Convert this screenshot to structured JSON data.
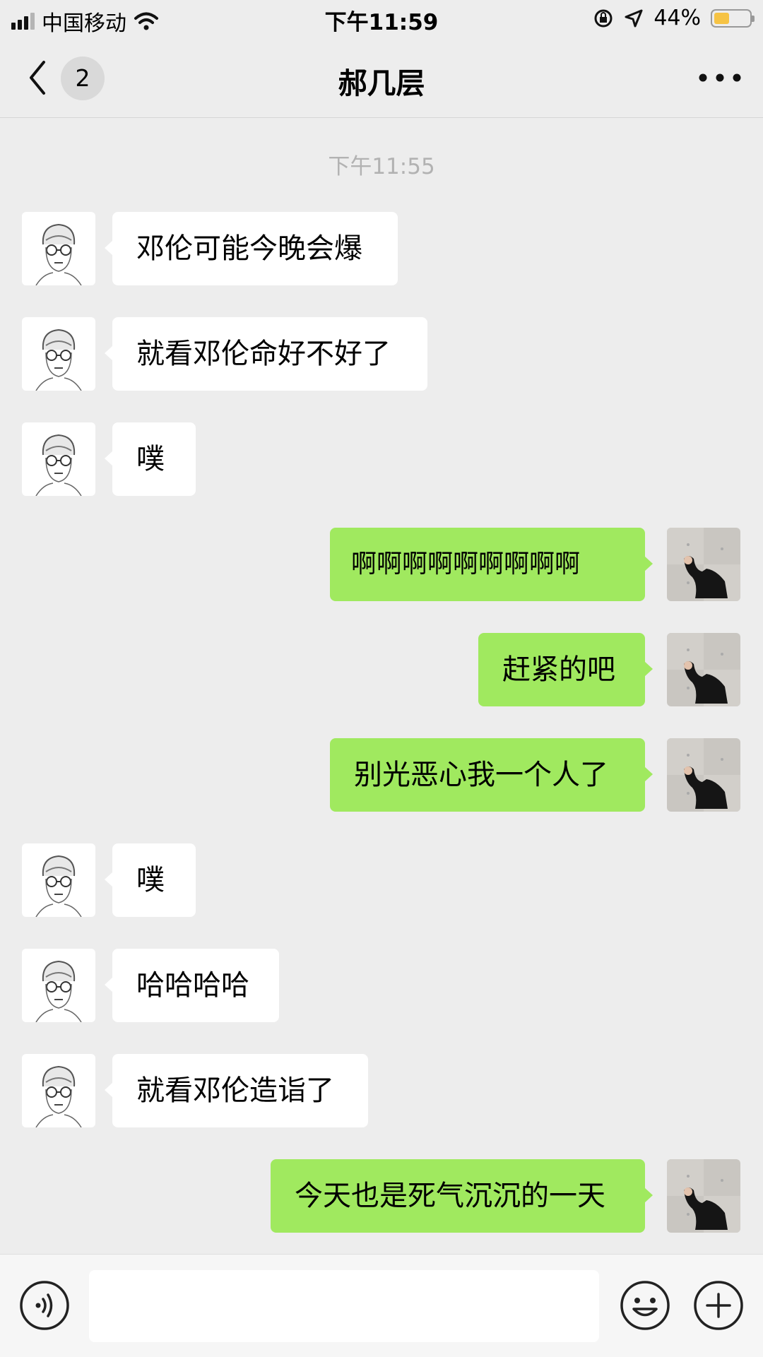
{
  "status_bar": {
    "carrier": "中国移动",
    "time": "下午11:59",
    "battery": "44%",
    "battery_level": 0.44
  },
  "nav": {
    "unread_count": "2",
    "title": "郝几层"
  },
  "chat": {
    "timestamp": "下午11:55",
    "messages": [
      {
        "side": "in",
        "text": "邓伦可能今晚会爆"
      },
      {
        "side": "in",
        "text": "就看邓伦命好不好了"
      },
      {
        "side": "in",
        "text": "噗"
      },
      {
        "side": "out",
        "text": "啊啊啊啊啊啊啊啊啊"
      },
      {
        "side": "out",
        "text": "赶紧的吧"
      },
      {
        "side": "out",
        "text": "别光恶心我一个人了"
      },
      {
        "side": "in",
        "text": "噗"
      },
      {
        "side": "in",
        "text": "哈哈哈哈"
      },
      {
        "side": "in",
        "text": "就看邓伦造诣了"
      },
      {
        "side": "out",
        "text": "今天也是死气沉沉的一天"
      }
    ]
  },
  "input_bar": {
    "placeholder": ""
  },
  "colors": {
    "background": "#ededed",
    "outgoing_bubble": "#a0e95f",
    "incoming_bubble": "#ffffff",
    "battery_fill": "#f6c344"
  },
  "icons": {
    "back": "chevron-left-icon",
    "more": "more-dots-icon",
    "voice": "voice-icon",
    "emoji": "emoji-icon",
    "plus": "plus-icon",
    "signal": "signal-icon",
    "wifi": "wifi-icon",
    "rotation_lock": "rotation-lock-icon",
    "location": "location-arrow-icon",
    "battery": "battery-icon"
  }
}
